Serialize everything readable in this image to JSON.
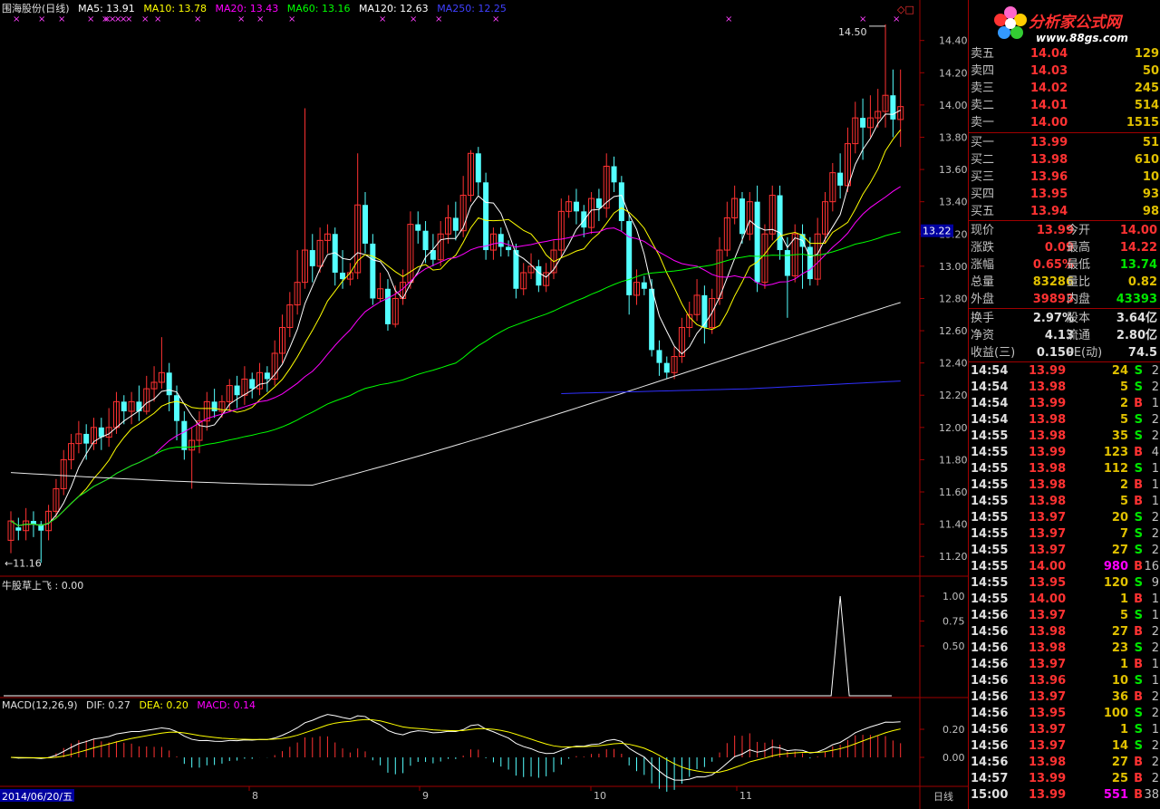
{
  "header": {
    "title": "围海股份(日线)",
    "ma": [
      {
        "label": "MA5: 13.91",
        "color": "#ffffff"
      },
      {
        "label": "MA10: 13.78",
        "color": "#ffff00"
      },
      {
        "label": "MA20: 13.43",
        "color": "#ff00ff"
      },
      {
        "label": "MA60: 13.16",
        "color": "#00ff00"
      },
      {
        "label": "MA120: 12.63",
        "color": "#ffffff"
      },
      {
        "label": "MA250: 12.25",
        "color": "#0000ff"
      }
    ]
  },
  "chart_data": {
    "type": "candlestick",
    "price_ticks": [
      "14.40",
      "14.20",
      "14.00",
      "13.80",
      "13.60",
      "13.40",
      "13.20",
      "13.00",
      "12.80",
      "12.60",
      "12.40",
      "12.20",
      "12.00",
      "11.80",
      "11.60",
      "11.40",
      "11.20"
    ],
    "current_marker": "13.22",
    "high_label": "14.50",
    "low_label": "11.16",
    "month_labels": [
      "8",
      "9",
      "10",
      "11"
    ],
    "candles": [
      [
        11.3,
        11.42,
        11.22,
        11.48
      ],
      [
        11.38,
        11.36,
        11.3,
        11.44
      ],
      [
        11.36,
        11.42,
        11.3,
        11.5
      ],
      [
        11.42,
        11.4,
        11.32,
        11.48
      ],
      [
        11.4,
        11.36,
        11.16,
        11.42
      ],
      [
        11.36,
        11.48,
        11.3,
        11.52
      ],
      [
        11.48,
        11.62,
        11.44,
        11.68
      ],
      [
        11.62,
        11.8,
        11.58,
        11.86
      ],
      [
        11.8,
        11.9,
        11.74,
        11.96
      ],
      [
        11.9,
        11.96,
        11.84,
        12.04
      ],
      [
        11.96,
        11.9,
        11.8,
        12.02
      ],
      [
        11.9,
        12.0,
        11.86,
        12.06
      ],
      [
        12.0,
        11.94,
        11.86,
        12.06
      ],
      [
        11.94,
        12.0,
        11.88,
        12.12
      ],
      [
        12.0,
        12.16,
        11.96,
        12.22
      ],
      [
        12.16,
        12.1,
        12.02,
        12.2
      ],
      [
        12.1,
        12.16,
        12.02,
        12.22
      ],
      [
        12.16,
        12.1,
        12.04,
        12.26
      ],
      [
        12.1,
        12.24,
        12.08,
        12.32
      ],
      [
        12.24,
        12.28,
        12.16,
        12.38
      ],
      [
        12.28,
        12.34,
        12.24,
        12.56
      ],
      [
        12.34,
        12.2,
        12.1,
        12.4
      ],
      [
        12.2,
        12.04,
        11.92,
        12.26
      ],
      [
        12.04,
        11.86,
        11.8,
        12.1
      ],
      [
        11.86,
        11.92,
        11.62,
        12.0
      ],
      [
        11.92,
        12.04,
        11.84,
        12.1
      ],
      [
        12.04,
        12.16,
        11.98,
        12.22
      ],
      [
        12.16,
        12.1,
        12.06,
        12.24
      ],
      [
        12.1,
        12.16,
        12.06,
        12.2
      ],
      [
        12.16,
        12.26,
        12.1,
        12.3
      ],
      [
        12.26,
        12.2,
        12.12,
        12.32
      ],
      [
        12.2,
        12.3,
        12.14,
        12.38
      ],
      [
        12.3,
        12.24,
        12.18,
        12.34
      ],
      [
        12.24,
        12.34,
        12.2,
        12.4
      ],
      [
        12.34,
        12.3,
        12.22,
        12.38
      ],
      [
        12.3,
        12.46,
        12.26,
        12.54
      ],
      [
        12.46,
        12.62,
        12.4,
        12.7
      ],
      [
        12.62,
        12.76,
        12.56,
        12.84
      ],
      [
        12.76,
        12.9,
        12.7,
        13.1
      ],
      [
        12.9,
        13.1,
        12.86,
        13.98
      ],
      [
        13.1,
        13.0,
        12.9,
        13.2
      ],
      [
        13.0,
        13.16,
        12.96,
        13.24
      ],
      [
        13.16,
        13.2,
        13.08,
        13.26
      ],
      [
        13.2,
        12.96,
        12.88,
        13.24
      ],
      [
        12.96,
        12.92,
        12.86,
        13.1
      ],
      [
        12.92,
        12.96,
        12.88,
        13.02
      ],
      [
        12.96,
        13.38,
        12.92,
        13.7
      ],
      [
        13.38,
        13.14,
        13.08,
        13.46
      ],
      [
        13.14,
        12.8,
        12.76,
        13.2
      ],
      [
        12.8,
        12.86,
        12.78,
        12.96
      ],
      [
        12.86,
        12.64,
        12.6,
        12.92
      ],
      [
        12.64,
        12.8,
        12.62,
        12.88
      ],
      [
        12.8,
        12.9,
        12.76,
        12.98
      ],
      [
        12.9,
        13.26,
        12.86,
        13.34
      ],
      [
        13.26,
        13.22,
        13.14,
        13.34
      ],
      [
        13.22,
        13.1,
        13.02,
        13.28
      ],
      [
        13.1,
        13.04,
        13.0,
        13.2
      ],
      [
        13.04,
        13.2,
        13.0,
        13.28
      ],
      [
        13.2,
        13.3,
        13.14,
        13.38
      ],
      [
        13.3,
        13.22,
        13.16,
        13.4
      ],
      [
        13.22,
        13.44,
        13.18,
        13.56
      ],
      [
        13.44,
        13.7,
        13.4,
        13.72
      ],
      [
        13.7,
        13.52,
        13.44,
        13.74
      ],
      [
        13.52,
        13.1,
        13.04,
        13.58
      ],
      [
        13.1,
        13.2,
        13.04,
        13.24
      ],
      [
        13.2,
        13.12,
        13.06,
        13.24
      ],
      [
        13.12,
        13.1,
        13.06,
        13.16
      ],
      [
        13.1,
        12.86,
        12.8,
        13.14
      ],
      [
        12.86,
        12.96,
        12.82,
        13.02
      ],
      [
        12.96,
        13.0,
        12.92,
        13.08
      ],
      [
        13.0,
        12.88,
        12.84,
        13.04
      ],
      [
        12.88,
        12.96,
        12.84,
        13.02
      ],
      [
        12.96,
        13.1,
        12.92,
        13.16
      ],
      [
        13.1,
        13.34,
        13.06,
        13.42
      ],
      [
        13.34,
        13.4,
        13.3,
        13.44
      ],
      [
        13.4,
        13.34,
        13.26,
        13.48
      ],
      [
        13.34,
        13.24,
        13.18,
        13.38
      ],
      [
        13.24,
        13.42,
        13.2,
        13.46
      ],
      [
        13.42,
        13.36,
        13.28,
        13.48
      ],
      [
        13.36,
        13.62,
        13.3,
        13.7
      ],
      [
        13.62,
        13.52,
        13.46,
        13.68
      ],
      [
        13.52,
        13.28,
        13.22,
        13.56
      ],
      [
        13.28,
        12.82,
        12.7,
        13.32
      ],
      [
        12.82,
        12.9,
        12.76,
        12.98
      ],
      [
        12.9,
        12.86,
        12.82,
        12.94
      ],
      [
        12.86,
        12.48,
        12.44,
        12.92
      ],
      [
        12.48,
        12.4,
        12.32,
        12.54
      ],
      [
        12.4,
        12.34,
        12.3,
        12.44
      ],
      [
        12.34,
        12.44,
        12.3,
        12.5
      ],
      [
        12.44,
        12.62,
        12.4,
        12.68
      ],
      [
        12.62,
        12.7,
        12.56,
        12.78
      ],
      [
        12.7,
        12.82,
        12.66,
        12.92
      ],
      [
        12.82,
        12.62,
        12.52,
        12.88
      ],
      [
        12.62,
        12.8,
        12.58,
        12.86
      ],
      [
        12.8,
        13.1,
        12.76,
        13.18
      ],
      [
        13.1,
        13.3,
        13.06,
        13.4
      ],
      [
        13.3,
        13.42,
        13.26,
        13.5
      ],
      [
        13.42,
        13.2,
        13.14,
        13.46
      ],
      [
        13.2,
        13.4,
        13.16,
        13.46
      ],
      [
        13.4,
        12.9,
        12.84,
        13.5
      ],
      [
        12.9,
        13.2,
        12.86,
        13.26
      ],
      [
        13.2,
        13.44,
        13.16,
        13.5
      ],
      [
        13.44,
        13.1,
        13.04,
        13.5
      ],
      [
        13.1,
        12.94,
        12.68,
        13.18
      ],
      [
        12.94,
        13.2,
        12.9,
        13.26
      ],
      [
        13.2,
        13.12,
        12.86,
        13.26
      ],
      [
        13.12,
        12.92,
        12.88,
        13.18
      ],
      [
        12.92,
        13.2,
        12.88,
        13.3
      ],
      [
        13.2,
        13.4,
        13.14,
        13.46
      ],
      [
        13.4,
        13.58,
        13.34,
        13.64
      ],
      [
        13.58,
        13.5,
        13.42,
        13.7
      ],
      [
        13.5,
        13.76,
        13.46,
        13.86
      ],
      [
        13.76,
        13.92,
        13.7,
        14.02
      ],
      [
        13.92,
        13.86,
        13.66,
        14.04
      ],
      [
        13.86,
        13.92,
        13.8,
        14.06
      ],
      [
        13.92,
        13.96,
        13.86,
        14.1
      ],
      [
        13.96,
        14.06,
        13.86,
        14.5
      ],
      [
        14.06,
        13.91,
        13.8,
        14.22
      ],
      [
        13.91,
        13.99,
        13.74,
        14.22
      ]
    ],
    "indicator": {
      "title": "牛股草上飞 : 0.00",
      "ticks": [
        "1.00",
        "0.75",
        "0.50"
      ]
    },
    "macd": {
      "title": "MACD(12,26,9)",
      "dif": "DIF: 0.27",
      "dea": "DEA: 0.20",
      "macd": "MACD: 0.14",
      "ticks": [
        "0.20",
        "0.00"
      ]
    }
  },
  "date_tab": "2014/06/20/五",
  "period_tab": "日线",
  "logo": {
    "text": "分析家公式网",
    "url": "www.88gs.com"
  },
  "order_book": {
    "sell": [
      {
        "label": "卖五",
        "price": "14.04",
        "vol": "129"
      },
      {
        "label": "卖四",
        "price": "14.03",
        "vol": "50"
      },
      {
        "label": "卖三",
        "price": "14.02",
        "vol": "245"
      },
      {
        "label": "卖二",
        "price": "14.01",
        "vol": "514"
      },
      {
        "label": "卖一",
        "price": "14.00",
        "vol": "1515"
      }
    ],
    "buy": [
      {
        "label": "买一",
        "price": "13.99",
        "vol": "51"
      },
      {
        "label": "买二",
        "price": "13.98",
        "vol": "610"
      },
      {
        "label": "买三",
        "price": "13.96",
        "vol": "10"
      },
      {
        "label": "买四",
        "price": "13.95",
        "vol": "93"
      },
      {
        "label": "买五",
        "price": "13.94",
        "vol": "98"
      }
    ]
  },
  "stats": [
    {
      "k1": "现价",
      "v1": "13.99",
      "c1": "red",
      "k2": "今开",
      "v2": "14.00",
      "c2": "red"
    },
    {
      "k1": "涨跌",
      "v1": "0.09",
      "c1": "red",
      "k2": "最高",
      "v2": "14.22",
      "c2": "red"
    },
    {
      "k1": "涨幅",
      "v1": "0.65%",
      "c1": "red",
      "k2": "最低",
      "v2": "13.74",
      "c2": "grn"
    },
    {
      "k1": "总量",
      "v1": "83286",
      "c1": "yel",
      "k2": "量比",
      "v2": "0.82",
      "c2": "yel"
    },
    {
      "k1": "外盘",
      "v1": "39893",
      "c1": "red",
      "k2": "内盘",
      "v2": "43393",
      "c2": "grn"
    }
  ],
  "stats2": [
    {
      "k1": "换手",
      "v1": "2.97%",
      "k2": "股本",
      "v2": "3.64亿"
    },
    {
      "k1": "净资",
      "v1": "4.13",
      "k2": "流通",
      "v2": "2.80亿"
    },
    {
      "k1": "收益(三)",
      "v1": "0.150",
      "k2": "PE(动)",
      "v2": "74.5"
    }
  ],
  "ticks": [
    {
      "t": "14:54",
      "p": "13.99",
      "pc": "red",
      "v": "24",
      "vc": "yel",
      "d": "S",
      "dc": "grn",
      "n": "2"
    },
    {
      "t": "14:54",
      "p": "13.98",
      "pc": "red",
      "v": "5",
      "vc": "yel",
      "d": "S",
      "dc": "grn",
      "n": "2"
    },
    {
      "t": "14:54",
      "p": "13.99",
      "pc": "red",
      "v": "2",
      "vc": "yel",
      "d": "B",
      "dc": "red",
      "n": "1"
    },
    {
      "t": "14:54",
      "p": "13.98",
      "pc": "red",
      "v": "5",
      "vc": "yel",
      "d": "S",
      "dc": "grn",
      "n": "2"
    },
    {
      "t": "14:55",
      "p": "13.98",
      "pc": "red",
      "v": "35",
      "vc": "yel",
      "d": "S",
      "dc": "grn",
      "n": "2"
    },
    {
      "t": "14:55",
      "p": "13.99",
      "pc": "red",
      "v": "123",
      "vc": "yel",
      "d": "B",
      "dc": "red",
      "n": "4"
    },
    {
      "t": "14:55",
      "p": "13.98",
      "pc": "red",
      "v": "112",
      "vc": "yel",
      "d": "S",
      "dc": "grn",
      "n": "1"
    },
    {
      "t": "14:55",
      "p": "13.98",
      "pc": "red",
      "v": "2",
      "vc": "yel",
      "d": "B",
      "dc": "red",
      "n": "1"
    },
    {
      "t": "14:55",
      "p": "13.98",
      "pc": "red",
      "v": "5",
      "vc": "yel",
      "d": "B",
      "dc": "red",
      "n": "1"
    },
    {
      "t": "14:55",
      "p": "13.97",
      "pc": "red",
      "v": "20",
      "vc": "yel",
      "d": "S",
      "dc": "grn",
      "n": "2"
    },
    {
      "t": "14:55",
      "p": "13.97",
      "pc": "red",
      "v": "7",
      "vc": "yel",
      "d": "S",
      "dc": "grn",
      "n": "2"
    },
    {
      "t": "14:55",
      "p": "13.97",
      "pc": "red",
      "v": "27",
      "vc": "yel",
      "d": "S",
      "dc": "grn",
      "n": "2"
    },
    {
      "t": "14:55",
      "p": "14.00",
      "pc": "red",
      "v": "980",
      "vc": "mag",
      "d": "B",
      "dc": "red",
      "n": "16"
    },
    {
      "t": "14:55",
      "p": "13.95",
      "pc": "red",
      "v": "120",
      "vc": "yel",
      "d": "S",
      "dc": "grn",
      "n": "9"
    },
    {
      "t": "14:55",
      "p": "14.00",
      "pc": "red",
      "v": "1",
      "vc": "yel",
      "d": "B",
      "dc": "red",
      "n": "1"
    },
    {
      "t": "14:56",
      "p": "13.97",
      "pc": "red",
      "v": "5",
      "vc": "yel",
      "d": "S",
      "dc": "grn",
      "n": "1"
    },
    {
      "t": "14:56",
      "p": "13.98",
      "pc": "red",
      "v": "27",
      "vc": "yel",
      "d": "B",
      "dc": "red",
      "n": "2"
    },
    {
      "t": "14:56",
      "p": "13.98",
      "pc": "red",
      "v": "23",
      "vc": "yel",
      "d": "S",
      "dc": "grn",
      "n": "2"
    },
    {
      "t": "14:56",
      "p": "13.97",
      "pc": "red",
      "v": "1",
      "vc": "yel",
      "d": "B",
      "dc": "red",
      "n": "1"
    },
    {
      "t": "14:56",
      "p": "13.96",
      "pc": "red",
      "v": "10",
      "vc": "yel",
      "d": "S",
      "dc": "grn",
      "n": "1"
    },
    {
      "t": "14:56",
      "p": "13.97",
      "pc": "red",
      "v": "36",
      "vc": "yel",
      "d": "B",
      "dc": "red",
      "n": "2"
    },
    {
      "t": "14:56",
      "p": "13.95",
      "pc": "red",
      "v": "100",
      "vc": "yel",
      "d": "S",
      "dc": "grn",
      "n": "2"
    },
    {
      "t": "14:56",
      "p": "13.97",
      "pc": "red",
      "v": "1",
      "vc": "yel",
      "d": "S",
      "dc": "grn",
      "n": "1"
    },
    {
      "t": "14:56",
      "p": "13.97",
      "pc": "red",
      "v": "14",
      "vc": "yel",
      "d": "S",
      "dc": "grn",
      "n": "2"
    },
    {
      "t": "14:56",
      "p": "13.98",
      "pc": "red",
      "v": "27",
      "vc": "yel",
      "d": "B",
      "dc": "red",
      "n": "2"
    },
    {
      "t": "14:57",
      "p": "13.99",
      "pc": "red",
      "v": "25",
      "vc": "yel",
      "d": "B",
      "dc": "red",
      "n": "2"
    },
    {
      "t": "15:00",
      "p": "13.99",
      "pc": "red",
      "v": "551",
      "vc": "mag",
      "d": "B",
      "dc": "red",
      "n": "38"
    }
  ]
}
